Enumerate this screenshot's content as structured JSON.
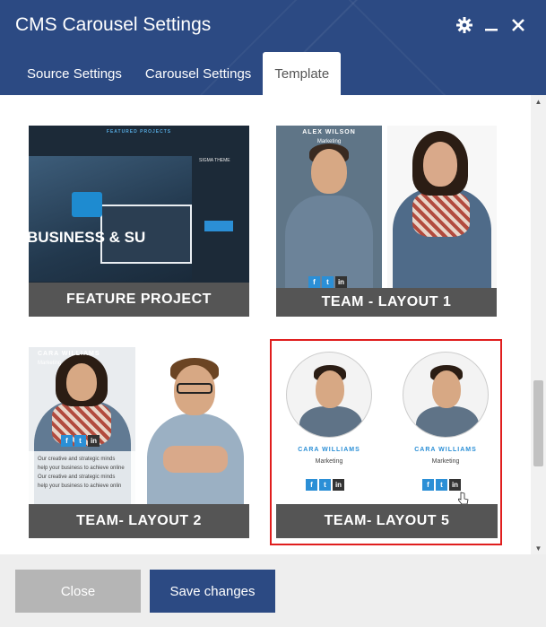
{
  "dialog": {
    "title": "CMS Carousel Settings"
  },
  "header_icons": [
    "gear-icon",
    "minimize-icon",
    "close-icon"
  ],
  "tabs": [
    {
      "label": "Source Settings",
      "active": false
    },
    {
      "label": "Carousel Settings",
      "active": false
    },
    {
      "label": "Template",
      "active": true
    }
  ],
  "templates": [
    {
      "label": "FEATURE PROJECT",
      "preview": {
        "heading": "FEATURED PROJECTS",
        "side_title": "SIGMA THEME",
        "hero_text": "BUSINESS & SU"
      }
    },
    {
      "label": "TEAM - LAYOUT 1",
      "preview": {
        "member_name": "ALEX WILSON",
        "member_role": "Marketing"
      }
    },
    {
      "label": "TEAM- LAYOUT 2",
      "preview": {
        "member_name": "CARA WILLIAMS",
        "member_role": "Marketing",
        "bio": "Our creative and strategic minds help your business to achieve online Our creative and strategic minds help your business to achieve onlin"
      }
    },
    {
      "label": "TEAM- LAYOUT 5",
      "selected": true,
      "preview": {
        "member_name": "CARA WILLIAMS",
        "member_role": "Marketing"
      }
    }
  ],
  "social_icons": [
    "f",
    "t",
    "in"
  ],
  "footer": {
    "close_label": "Close",
    "save_label": "Save changes"
  },
  "colors": {
    "header_bg": "#2c4a83",
    "selected_border": "#e01e1e",
    "label_bg": "#555555",
    "save_bg": "#2c4a83",
    "close_bg": "#b5b5b5"
  }
}
